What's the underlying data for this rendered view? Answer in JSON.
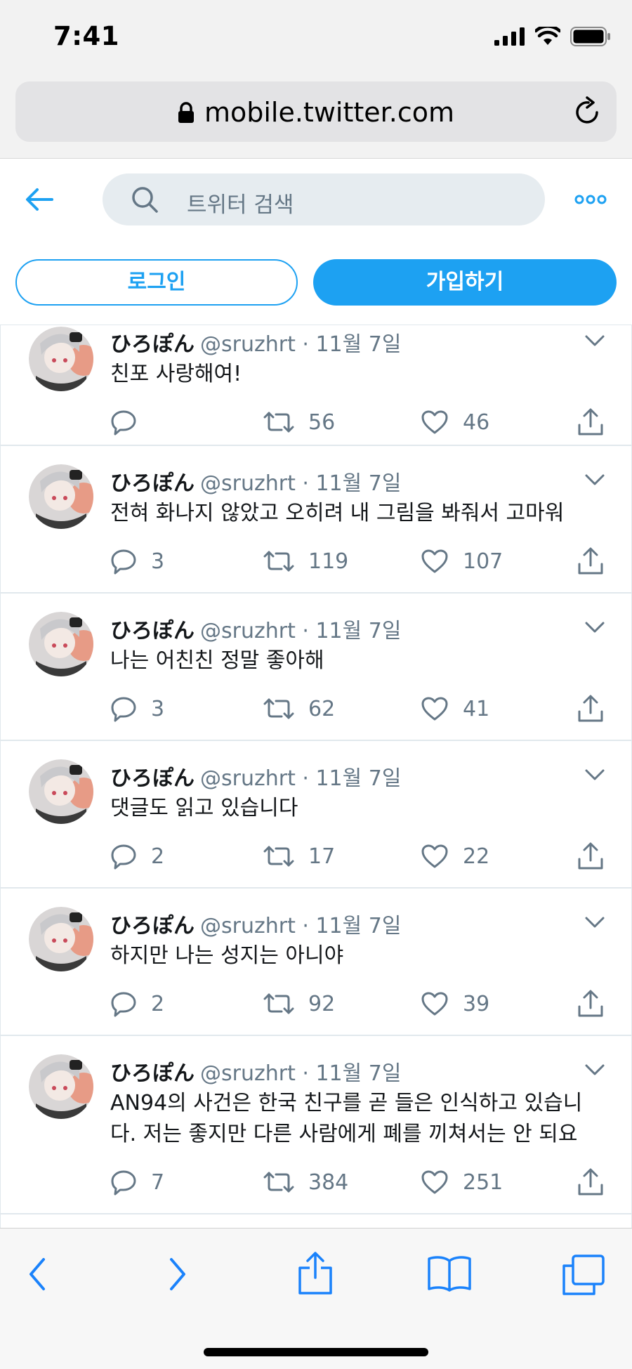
{
  "status": {
    "time": "7:41"
  },
  "browser": {
    "url": "mobile.twitter.com"
  },
  "header": {
    "search_placeholder": "트위터 검색",
    "login_label": "로그인",
    "signup_label": "가입하기"
  },
  "colors": {
    "accent": "#1da1f2",
    "muted": "#657786",
    "divider": "#e1e8ed"
  },
  "tweets": [
    {
      "name": "ひろぽん",
      "meta": "@sruzhrt · 11월 7일",
      "text": [
        "친포 사랑해여!"
      ],
      "replies": "",
      "retweets": "56",
      "likes": "46"
    },
    {
      "name": "ひろぽん",
      "meta": "@sruzhrt · 11월 7일",
      "text": [
        "전혀 화나지 않았고 오히려 내 그림을 봐줘서 고마워"
      ],
      "replies": "3",
      "retweets": "119",
      "likes": "107"
    },
    {
      "name": "ひろぽん",
      "meta": "@sruzhrt · 11월 7일",
      "text": [
        "나는 어친친 정말 좋아해"
      ],
      "replies": "3",
      "retweets": "62",
      "likes": "41"
    },
    {
      "name": "ひろぽん",
      "meta": "@sruzhrt · 11월 7일",
      "text": [
        "댓글도 읽고 있습니다"
      ],
      "replies": "2",
      "retweets": "17",
      "likes": "22"
    },
    {
      "name": "ひろぽん",
      "meta": "@sruzhrt · 11월 7일",
      "text": [
        "하지만 나는 성지는 아니야"
      ],
      "replies": "2",
      "retweets": "92",
      "likes": "39"
    },
    {
      "name": "ひろぽん",
      "meta": "@sruzhrt · 11월 7일",
      "text": [
        "AN94의 사건은 한국 친구를 곧 들은 인식하고 있습니",
        "다. 저는 좋지만 다른 사람에게 폐를 끼쳐서는 안 되요"
      ],
      "replies": "7",
      "retweets": "384",
      "likes": "251"
    }
  ],
  "icons": {
    "lock": "lock-icon",
    "reload": "reload-icon",
    "back": "back-arrow-icon",
    "search": "search-icon",
    "more": "more-dots-icon",
    "reply": "reply-icon",
    "retweet": "retweet-icon",
    "like": "heart-icon",
    "share": "share-icon",
    "chevron": "chevron-down-icon"
  }
}
